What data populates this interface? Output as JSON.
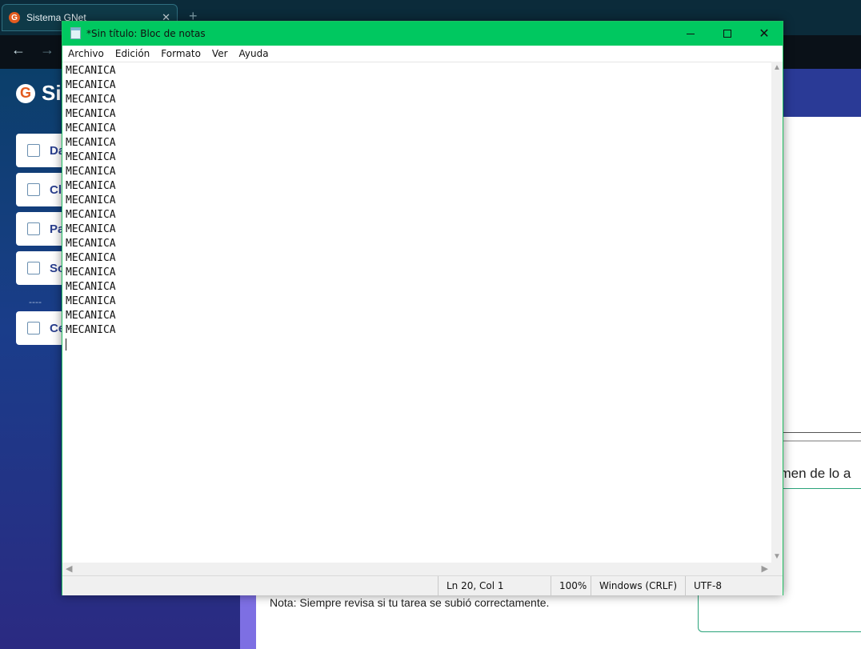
{
  "browser": {
    "tab_title": "Sistema GNet",
    "tab_close": "✕",
    "new_tab": "+",
    "back": "←",
    "forward": "→"
  },
  "webpage": {
    "brand_letter": "G",
    "brand_text": "Si",
    "sidebar": [
      {
        "label": "Da",
        "icon": "grid-icon"
      },
      {
        "label": "Cl",
        "icon": "notebook-icon"
      },
      {
        "label": "Pa",
        "icon": "table-icon"
      },
      {
        "label": "So",
        "icon": "bar-chart-icon"
      },
      {
        "label": "Ce",
        "icon": "sign-out-icon"
      }
    ],
    "separator": "----",
    "resumen_text": "umen de lo a",
    "nota_text": "Nota: Siempre revisa si tu tarea se subió correctamente."
  },
  "notepad": {
    "title": "*Sin título: Bloc de notas",
    "menu": [
      "Archivo",
      "Edición",
      "Formato",
      "Ver",
      "Ayuda"
    ],
    "lines": [
      "MECANICA",
      "MECANICA",
      "MECANICA",
      "MECANICA",
      "MECANICA",
      "MECANICA",
      "MECANICA",
      "MECANICA",
      "MECANICA",
      "MECANICA",
      "MECANICA",
      "MECANICA",
      "MECANICA",
      "MECANICA",
      "MECANICA",
      "MECANICA",
      "MECANICA",
      "MECANICA",
      "MECANICA"
    ],
    "status": {
      "position": "Ln 20, Col 1",
      "zoom": "100%",
      "line_ending": "Windows (CRLF)",
      "encoding": "UTF-8"
    },
    "close_glyph": "✕"
  },
  "colors": {
    "title_bar": "#00c860",
    "brand_orange": "#e35b1f"
  }
}
